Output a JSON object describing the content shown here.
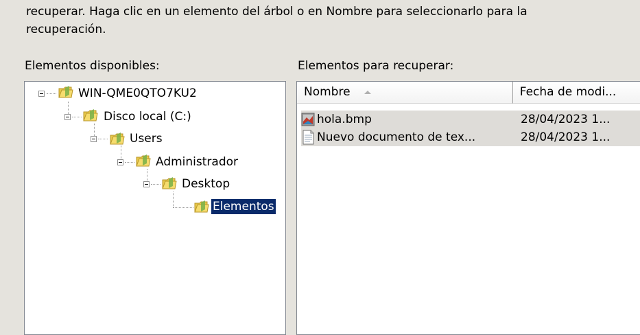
{
  "description": {
    "line1": "recuperar. Haga clic en un elemento del árbol o en Nombre para seleccionarlo para la",
    "line2": "recuperación."
  },
  "labels": {
    "available": "Elementos disponibles:",
    "to_recover": "Elementos para recuperar:"
  },
  "tree": {
    "nodes": [
      {
        "label": "WIN-QME0QTO7KU2",
        "icon": "folder-icon",
        "expanded": true
      },
      {
        "label": "Disco local (C:)",
        "icon": "folder-icon",
        "expanded": true
      },
      {
        "label": "Users",
        "icon": "folder-icon",
        "expanded": true
      },
      {
        "label": "Administrador",
        "icon": "folder-icon",
        "expanded": true
      },
      {
        "label": "Desktop",
        "icon": "folder-icon",
        "expanded": true
      },
      {
        "label": "Elementos",
        "icon": "folder-icon",
        "selected": true
      }
    ]
  },
  "list": {
    "columns": [
      {
        "label": "Nombre",
        "sorted": "ascending"
      },
      {
        "label": "Fecha de modi..."
      }
    ],
    "rows": [
      {
        "name": "hola.bmp",
        "date": "28/04/2023 1...",
        "icon": "bitmap-file-icon"
      },
      {
        "name": "Nuevo documento de tex...",
        "date": "28/04/2023 1...",
        "icon": "text-document-icon"
      }
    ]
  },
  "colors": {
    "selection": "#0a2a6a",
    "background": "#e5e3dd",
    "row_background": "#dedcd8"
  }
}
